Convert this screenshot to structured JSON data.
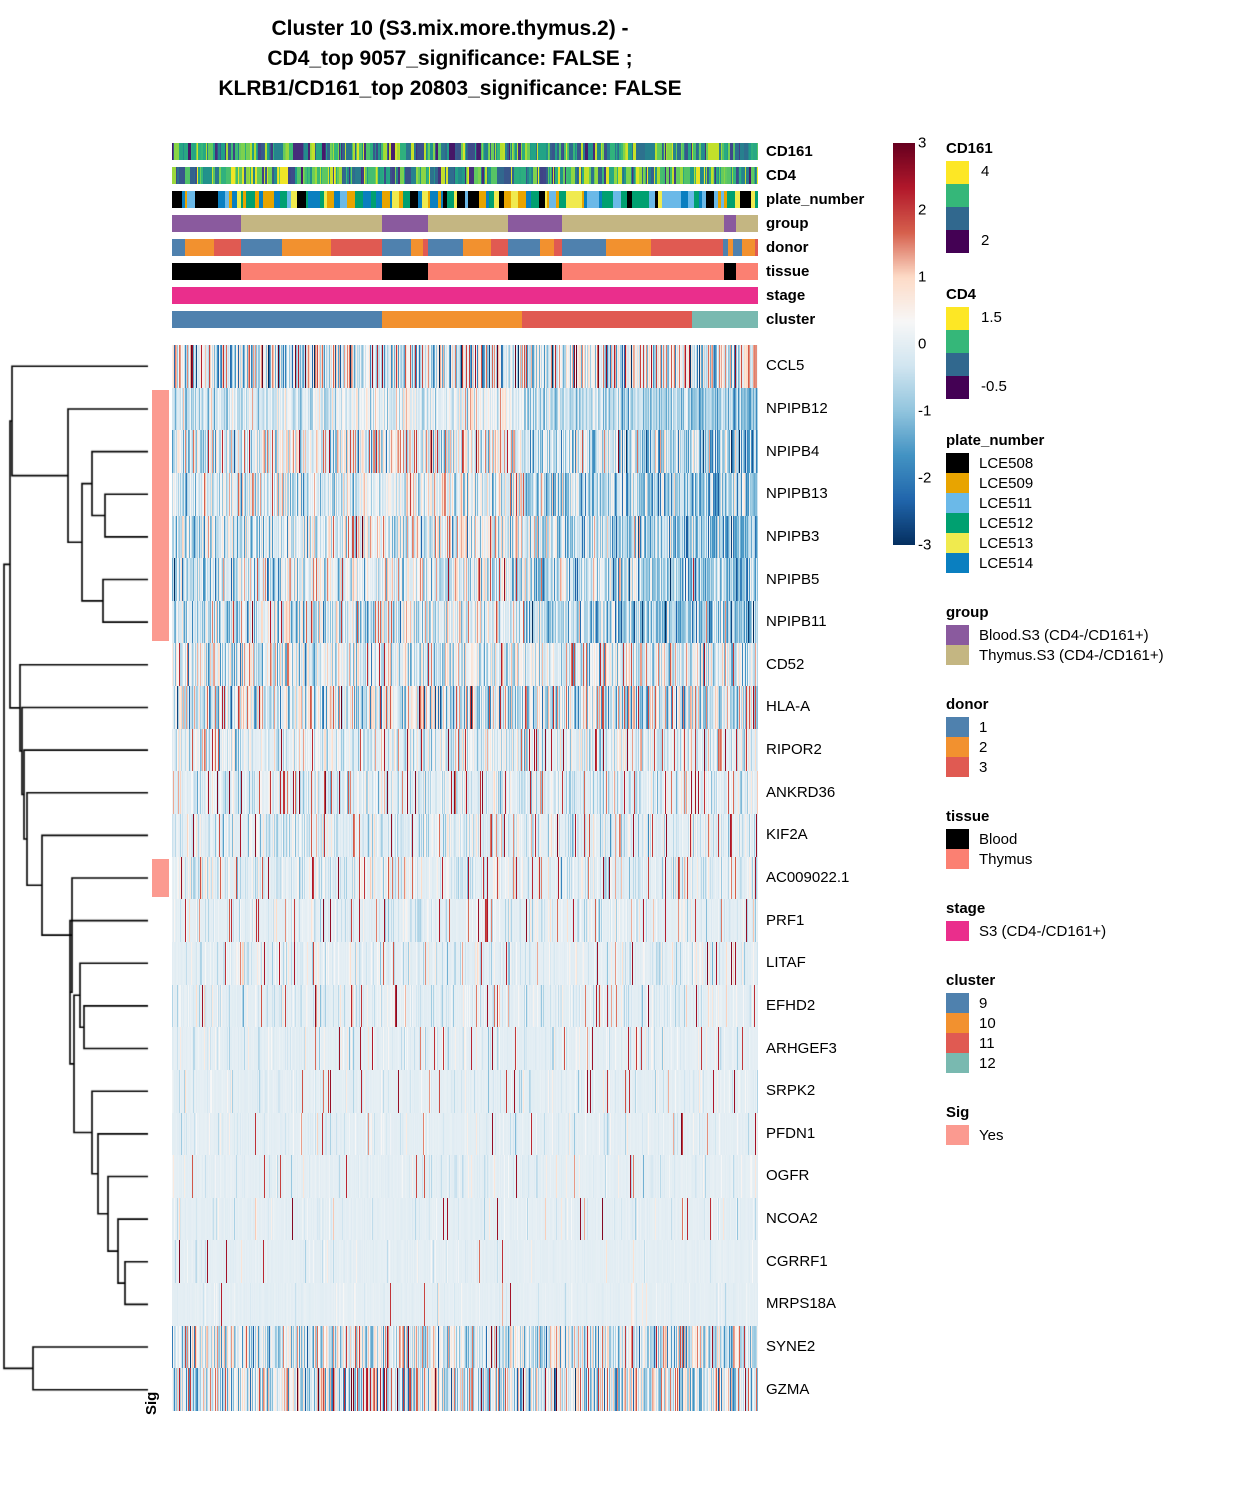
{
  "title": {
    "line1": "Cluster 10 (S3.mix.more.thymus.2) -",
    "line2": "CD4_top 9057_significance: FALSE ;",
    "line3": "KLRB1/CD161_top 20803_significance: FALSE"
  },
  "annotation_rows": [
    {
      "name": "CD161",
      "type": "continuous"
    },
    {
      "name": "CD4",
      "type": "continuous"
    },
    {
      "name": "plate_number",
      "type": "categorical"
    },
    {
      "name": "group",
      "type": "categorical"
    },
    {
      "name": "donor",
      "type": "categorical"
    },
    {
      "name": "tissue",
      "type": "categorical"
    },
    {
      "name": "stage",
      "type": "categorical"
    },
    {
      "name": "cluster",
      "type": "categorical"
    }
  ],
  "genes": [
    "CCL5",
    "NPIPB12",
    "NPIPB4",
    "NPIPB13",
    "NPIPB3",
    "NPIPB5",
    "NPIPB11",
    "CD52",
    "HLA-A",
    "RIPOR2",
    "ANKRD36",
    "KIF2A",
    "AC009022.1",
    "PRF1",
    "LITAF",
    "EFHD2",
    "ARHGEF3",
    "SRPK2",
    "PFDN1",
    "OGFR",
    "NCOA2",
    "CGRRF1",
    "MRPS18A",
    "SYNE2",
    "GZMA"
  ],
  "sig_rows": [
    "NPIPB12",
    "NPIPB4",
    "NPIPB13",
    "NPIPB3",
    "NPIPB5",
    "NPIPB11",
    "AC009022.1"
  ],
  "sig_axis_label": "Sig",
  "colorbar": {
    "ticks": [
      "3",
      "2",
      "1",
      "0",
      "-1",
      "-2",
      "-3"
    ],
    "min": -3,
    "max": 3,
    "low_color": "#053061",
    "mid_color": "#f7f7f7",
    "high_color": "#4a1216"
  },
  "legends": [
    {
      "title": "CD161",
      "style": "gradient",
      "swatches": [
        "#fde725",
        "#35b779",
        "#31688e",
        "#440154"
      ],
      "labels": [
        {
          "text": "4",
          "at": 0
        },
        {
          "text": "2",
          "at": 3
        }
      ]
    },
    {
      "title": "CD4",
      "style": "gradient",
      "swatches": [
        "#fde725",
        "#35b779",
        "#31688e",
        "#440154"
      ],
      "labels": [
        {
          "text": "1.5",
          "at": 0
        },
        {
          "text": "-0.5",
          "at": 3
        }
      ]
    },
    {
      "title": "plate_number",
      "style": "discrete",
      "items": [
        {
          "label": "LCE508",
          "color": "#000000"
        },
        {
          "label": "LCE509",
          "color": "#e8a400"
        },
        {
          "label": "LCE511",
          "color": "#6bb9e8"
        },
        {
          "label": "LCE512",
          "color": "#00a070"
        },
        {
          "label": "LCE513",
          "color": "#f0ea4e"
        },
        {
          "label": "LCE514",
          "color": "#0a7fc0"
        }
      ]
    },
    {
      "title": "group",
      "style": "discrete",
      "items": [
        {
          "label": "Blood.S3 (CD4-/CD161+)",
          "color": "#8a5a9e"
        },
        {
          "label": "Thymus.S3 (CD4-/CD161+)",
          "color": "#c4b682"
        }
      ]
    },
    {
      "title": "donor",
      "style": "discrete",
      "items": [
        {
          "label": "1",
          "color": "#4f81ae"
        },
        {
          "label": "2",
          "color": "#f2912f"
        },
        {
          "label": "3",
          "color": "#e05a52"
        }
      ]
    },
    {
      "title": "tissue",
      "style": "discrete",
      "items": [
        {
          "label": "Blood",
          "color": "#000000"
        },
        {
          "label": "Thymus",
          "color": "#fb8072"
        }
      ]
    },
    {
      "title": "stage",
      "style": "discrete",
      "items": [
        {
          "label": "S3 (CD4-/CD161+)",
          "color": "#ea2e8c"
        }
      ]
    },
    {
      "title": "cluster",
      "style": "discrete",
      "items": [
        {
          "label": "9",
          "color": "#4f81ae"
        },
        {
          "label": "10",
          "color": "#f2912f"
        },
        {
          "label": "11",
          "color": "#e05a52"
        },
        {
          "label": "12",
          "color": "#79b9b0"
        }
      ]
    },
    {
      "title": "Sig",
      "style": "discrete",
      "items": [
        {
          "label": "Yes",
          "color": "#fb9a90"
        }
      ]
    }
  ],
  "chart_data": {
    "type": "heatmap",
    "title": "Cluster 10 (S3.mix.more.thymus.2) - CD4_top 9057_significance: FALSE ; KLRB1/CD161_top 20803_significance: FALSE",
    "rows": [
      "CCL5",
      "NPIPB12",
      "NPIPB4",
      "NPIPB13",
      "NPIPB3",
      "NPIPB5",
      "NPIPB11",
      "CD52",
      "HLA-A",
      "RIPOR2",
      "ANKRD36",
      "KIF2A",
      "AC009022.1",
      "PRF1",
      "LITAF",
      "EFHD2",
      "ARHGEF3",
      "SRPK2",
      "PFDN1",
      "OGFR",
      "NCOA2",
      "CGRRF1",
      "MRPS18A",
      "SYNE2",
      "GZMA"
    ],
    "n_columns": 586,
    "value_range": [
      -3,
      3
    ],
    "colormap": "RdBu_r",
    "row_profiles": [
      {
        "gene": "CCL5",
        "mean": 0.05,
        "spread": 1.3,
        "sparsity": 0.0,
        "seed": 11
      },
      {
        "gene": "NPIPB12",
        "mean": -0.35,
        "spread": 0.55,
        "sparsity": 0.0,
        "seed": 12
      },
      {
        "gene": "NPIPB4",
        "mean": -0.15,
        "spread": 0.95,
        "sparsity": 0.0,
        "seed": 13
      },
      {
        "gene": "NPIPB13",
        "mean": -0.3,
        "spread": 0.8,
        "sparsity": 0.0,
        "seed": 14
      },
      {
        "gene": "NPIPB3",
        "mean": -0.3,
        "spread": 0.85,
        "sparsity": 0.0,
        "seed": 15
      },
      {
        "gene": "NPIPB5",
        "mean": -0.3,
        "spread": 0.85,
        "sparsity": 0.0,
        "seed": 16
      },
      {
        "gene": "NPIPB11",
        "mean": -0.3,
        "spread": 0.85,
        "sparsity": 0.0,
        "seed": 17
      },
      {
        "gene": "CD52",
        "mean": 0.05,
        "spread": 0.85,
        "sparsity": 0.0,
        "seed": 18
      },
      {
        "gene": "HLA-A",
        "mean": -0.1,
        "spread": 1.1,
        "sparsity": 0.0,
        "seed": 19
      },
      {
        "gene": "RIPOR2",
        "mean": -0.05,
        "spread": 0.6,
        "sparsity": 0.25,
        "seed": 20
      },
      {
        "gene": "ANKRD36",
        "mean": -0.15,
        "spread": 0.5,
        "sparsity": 0.3,
        "seed": 21
      },
      {
        "gene": "KIF2A",
        "mean": -0.1,
        "spread": 0.5,
        "sparsity": 0.35,
        "seed": 22
      },
      {
        "gene": "AC009022.1",
        "mean": -0.08,
        "spread": 0.5,
        "sparsity": 0.45,
        "seed": 23
      },
      {
        "gene": "PRF1",
        "mean": -0.05,
        "spread": 0.45,
        "sparsity": 0.55,
        "seed": 24
      },
      {
        "gene": "LITAF",
        "mean": -0.05,
        "spread": 0.45,
        "sparsity": 0.6,
        "seed": 25
      },
      {
        "gene": "EFHD2",
        "mean": -0.05,
        "spread": 0.45,
        "sparsity": 0.62,
        "seed": 26
      },
      {
        "gene": "ARHGEF3",
        "mean": -0.03,
        "spread": 0.4,
        "sparsity": 0.7,
        "seed": 27
      },
      {
        "gene": "SRPK2",
        "mean": -0.03,
        "spread": 0.4,
        "sparsity": 0.72,
        "seed": 28
      },
      {
        "gene": "PFDN1",
        "mean": -0.02,
        "spread": 0.4,
        "sparsity": 0.75,
        "seed": 29
      },
      {
        "gene": "OGFR",
        "mean": -0.02,
        "spread": 0.4,
        "sparsity": 0.82,
        "seed": 30
      },
      {
        "gene": "NCOA2",
        "mean": -0.02,
        "spread": 0.4,
        "sparsity": 0.85,
        "seed": 31
      },
      {
        "gene": "CGRRF1",
        "mean": -0.01,
        "spread": 0.4,
        "sparsity": 0.9,
        "seed": 32
      },
      {
        "gene": "MRPS18A",
        "mean": -0.01,
        "spread": 0.4,
        "sparsity": 0.92,
        "seed": 33
      },
      {
        "gene": "SYNE2",
        "mean": -0.05,
        "spread": 0.95,
        "sparsity": 0.0,
        "seed": 34
      },
      {
        "gene": "GZMA",
        "mean": 0.0,
        "spread": 1.1,
        "sparsity": 0.0,
        "seed": 35
      }
    ],
    "annotation_tracks": {
      "group": [
        {
          "value": "Blood.S3 (CD4-/CD161+)",
          "start": 0.0,
          "end": 0.118
        },
        {
          "value": "Thymus.S3 (CD4-/CD161+)",
          "start": 0.118,
          "end": 0.358
        },
        {
          "value": "Blood.S3 (CD4-/CD161+)",
          "start": 0.358,
          "end": 0.437
        },
        {
          "value": "Thymus.S3 (CD4-/CD161+)",
          "start": 0.437,
          "end": 0.574
        },
        {
          "value": "Blood.S3 (CD4-/CD161+)",
          "start": 0.574,
          "end": 0.666
        },
        {
          "value": "Thymus.S3 (CD4-/CD161+)",
          "start": 0.666,
          "end": 0.942
        },
        {
          "value": "Blood.S3 (CD4-/CD161+)",
          "start": 0.942,
          "end": 0.962
        },
        {
          "value": "Thymus.S3 (CD4-/CD161+)",
          "start": 0.962,
          "end": 1.0
        }
      ],
      "tissue": [
        {
          "value": "Blood",
          "start": 0.0,
          "end": 0.118
        },
        {
          "value": "Thymus",
          "start": 0.118,
          "end": 0.358
        },
        {
          "value": "Blood",
          "start": 0.358,
          "end": 0.437
        },
        {
          "value": "Thymus",
          "start": 0.437,
          "end": 0.574
        },
        {
          "value": "Blood",
          "start": 0.574,
          "end": 0.666
        },
        {
          "value": "Thymus",
          "start": 0.666,
          "end": 0.942
        },
        {
          "value": "Blood",
          "start": 0.942,
          "end": 0.962
        },
        {
          "value": "Thymus",
          "start": 0.962,
          "end": 1.0
        }
      ],
      "donor": [
        {
          "value": "1",
          "start": 0.0,
          "end": 0.022
        },
        {
          "value": "2",
          "start": 0.022,
          "end": 0.072
        },
        {
          "value": "3",
          "start": 0.072,
          "end": 0.118
        },
        {
          "value": "1",
          "start": 0.118,
          "end": 0.188
        },
        {
          "value": "2",
          "start": 0.188,
          "end": 0.272
        },
        {
          "value": "3",
          "start": 0.272,
          "end": 0.358
        },
        {
          "value": "1",
          "start": 0.358,
          "end": 0.408
        },
        {
          "value": "2",
          "start": 0.408,
          "end": 0.428
        },
        {
          "value": "3",
          "start": 0.428,
          "end": 0.437
        },
        {
          "value": "1",
          "start": 0.437,
          "end": 0.497
        },
        {
          "value": "2",
          "start": 0.497,
          "end": 0.545
        },
        {
          "value": "3",
          "start": 0.545,
          "end": 0.574
        },
        {
          "value": "1",
          "start": 0.574,
          "end": 0.628
        },
        {
          "value": "2",
          "start": 0.628,
          "end": 0.652
        },
        {
          "value": "3",
          "start": 0.652,
          "end": 0.666
        },
        {
          "value": "1",
          "start": 0.666,
          "end": 0.74
        },
        {
          "value": "2",
          "start": 0.74,
          "end": 0.818
        },
        {
          "value": "3",
          "start": 0.818,
          "end": 0.94
        },
        {
          "value": "1",
          "start": 0.94,
          "end": 0.948
        },
        {
          "value": "2",
          "start": 0.948,
          "end": 0.957
        },
        {
          "value": "1",
          "start": 0.957,
          "end": 0.972
        },
        {
          "value": "2",
          "start": 0.972,
          "end": 0.995
        },
        {
          "value": "3",
          "start": 0.995,
          "end": 1.0
        }
      ],
      "stage": [
        {
          "value": "S3 (CD4-/CD161+)",
          "start": 0.0,
          "end": 1.0
        }
      ],
      "cluster": [
        {
          "value": "9",
          "start": 0.0,
          "end": 0.358
        },
        {
          "value": "10",
          "start": 0.358,
          "end": 0.598
        },
        {
          "value": "11",
          "start": 0.598,
          "end": 0.888
        },
        {
          "value": "12",
          "start": 0.888,
          "end": 1.0
        }
      ]
    }
  }
}
